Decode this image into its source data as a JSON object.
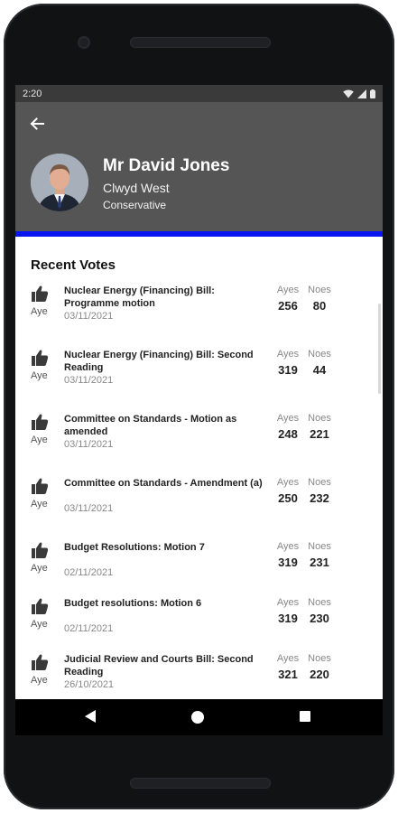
{
  "status_bar": {
    "time": "2:20"
  },
  "member": {
    "name": "Mr David Jones",
    "constituency": "Clwyd West",
    "party": "Conservative",
    "party_color": "#0a16f2"
  },
  "icons": {
    "back": "arrow-left-icon",
    "vote": "thumbs-up-icon"
  },
  "section_title": "Recent Votes",
  "columns": {
    "ayes": "Ayes",
    "noes": "Noes"
  },
  "votes": [
    {
      "vote": "Aye",
      "title": "Nuclear Energy (Financing) Bill: Programme motion",
      "date": "03/11/2021",
      "ayes": "256",
      "noes": "80"
    },
    {
      "vote": "Aye",
      "title": "Nuclear Energy (Financing) Bill: Second Reading",
      "date": "03/11/2021",
      "ayes": "319",
      "noes": "44"
    },
    {
      "vote": "Aye",
      "title": "Committee on Standards - Motion as amended",
      "date": "03/11/2021",
      "ayes": "248",
      "noes": "221"
    },
    {
      "vote": "Aye",
      "title": "Committee on Standards - Amendment (a)",
      "date": "03/11/2021",
      "ayes": "250",
      "noes": "232"
    },
    {
      "vote": "Aye",
      "title": "Budget Resolutions: Motion 7",
      "date": "02/11/2021",
      "ayes": "319",
      "noes": "231"
    },
    {
      "vote": "Aye",
      "title": "Budget resolutions: Motion 6",
      "date": "02/11/2021",
      "ayes": "319",
      "noes": "230"
    },
    {
      "vote": "Aye",
      "title": "Judicial Review and Courts Bill: Second Reading",
      "date": "26/10/2021",
      "ayes": "321",
      "noes": "220"
    }
  ]
}
